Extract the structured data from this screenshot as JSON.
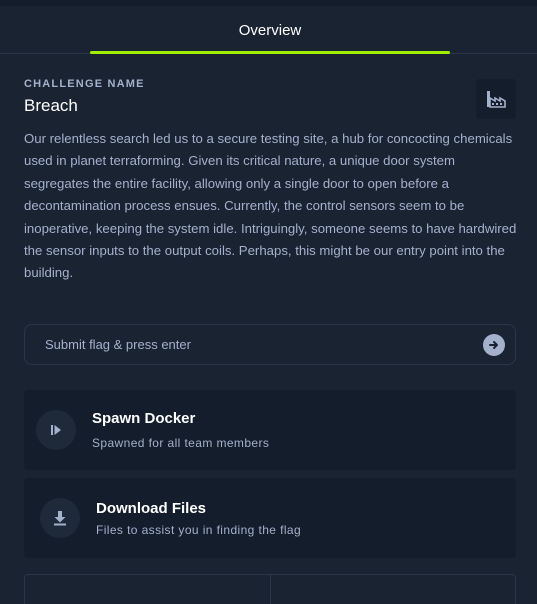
{
  "tabs": [
    {
      "label": "Overview",
      "active": true
    }
  ],
  "challenge": {
    "section_label": "CHALLENGE NAME",
    "name": "Breach",
    "category_icon": "factory-icon",
    "description": "Our relentless search led us to a secure testing site, a hub for concocting chemicals used in planet terraforming. Given its critical nature, a unique door system segregates the entire facility, allowing only a single door to open before a decontamination process ensues. Currently, the control sensors seem to be inoperative, keeping the system idle. Intriguingly, someone seems to have hardwired the sensor inputs to the output coils. Perhaps, this might be our entry point into the building."
  },
  "flag": {
    "placeholder": "Submit flag & press enter",
    "value": "",
    "submit_icon": "arrow-right-circle-icon"
  },
  "actions": {
    "spawn": {
      "title": "Spawn Docker",
      "subtitle": "Spawned for all team members",
      "icon": "play-icon"
    },
    "download": {
      "title": "Download Files",
      "subtitle": "Files to assist you in finding the flag",
      "icon": "download-icon"
    }
  },
  "colors": {
    "background": "#1a2332",
    "panel": "#141d2b",
    "accent": "#9fef00",
    "text_primary": "#ffffff",
    "text_secondary": "#a4b1cd",
    "border": "#2c3648"
  }
}
